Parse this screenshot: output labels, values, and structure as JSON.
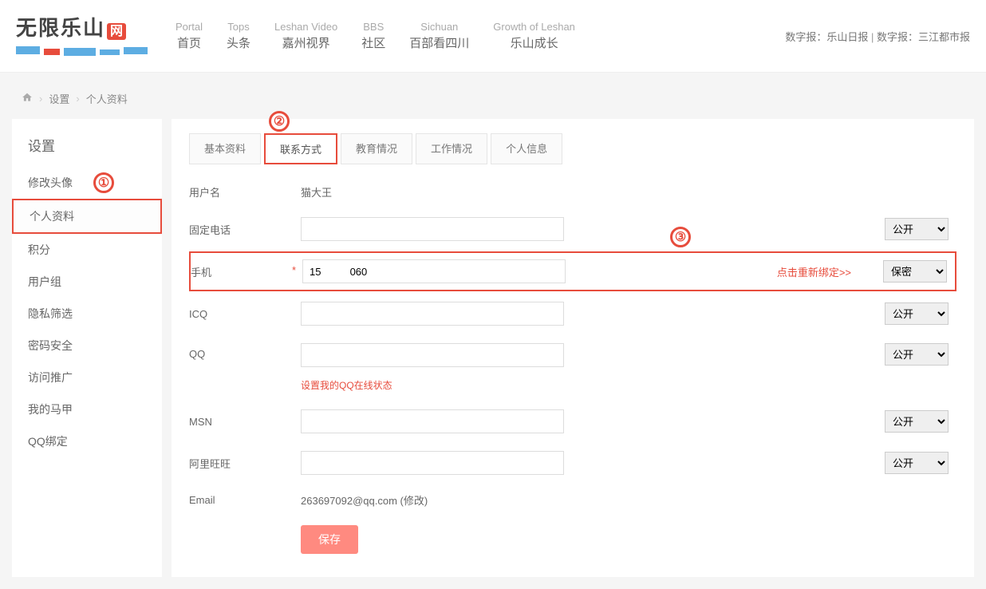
{
  "header": {
    "logo_text": "无限乐山",
    "logo_badge": "网",
    "nav": [
      {
        "en": "Portal",
        "cn": "首页"
      },
      {
        "en": "Tops",
        "cn": "头条"
      },
      {
        "en": "Leshan Video",
        "cn": "嘉州视界"
      },
      {
        "en": "BBS",
        "cn": "社区"
      },
      {
        "en": "Sichuan",
        "cn": "百部看四川"
      },
      {
        "en": "Growth of Leshan",
        "cn": "乐山成长"
      }
    ],
    "right_links": [
      "数字报：乐山日报",
      "数字报：三江都市报"
    ]
  },
  "breadcrumb": [
    "设置",
    "个人资料"
  ],
  "sidebar": {
    "title": "设置",
    "items": [
      "修改头像",
      "个人资料",
      "积分",
      "用户组",
      "隐私筛选",
      "密码安全",
      "访问推广",
      "我的马甲",
      "QQ绑定"
    ],
    "active_index": 1
  },
  "tabs": {
    "items": [
      "基本资料",
      "联系方式",
      "教育情况",
      "工作情况",
      "个人信息"
    ],
    "active_index": 1
  },
  "form": {
    "username_label": "用户名",
    "username_value": "猫大王",
    "phone_fixed_label": "固定电话",
    "phone_mobile_label": "手机",
    "phone_mobile_value": "15          060",
    "rebind_text": "点击重新绑定>>",
    "icq_label": "ICQ",
    "qq_label": "QQ",
    "qq_hint": "设置我的QQ在线状态",
    "msn_label": "MSN",
    "aliww_label": "阿里旺旺",
    "email_label": "Email",
    "email_value": "263697092@qq.com (修改)",
    "save_label": "保存"
  },
  "privacy": {
    "public": "公开",
    "private": "保密"
  },
  "annotations": {
    "a1": "①",
    "a2": "②",
    "a3": "③"
  }
}
